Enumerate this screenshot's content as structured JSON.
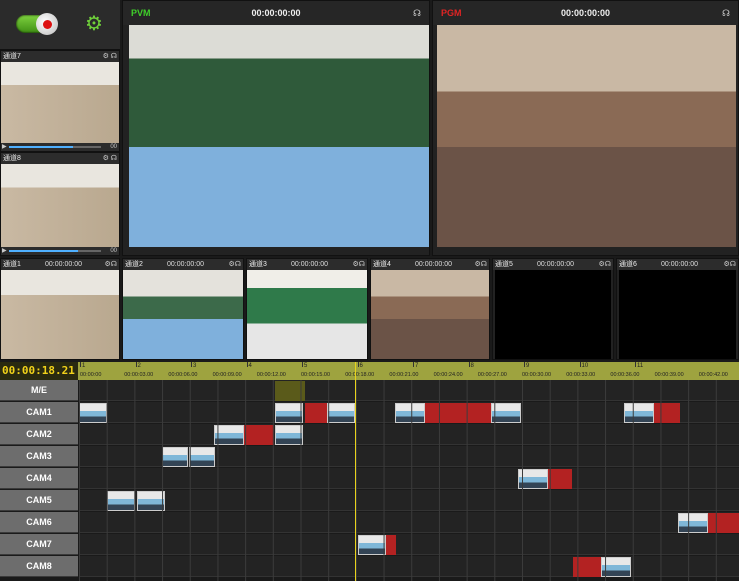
{
  "pvm": {
    "label": "PVM",
    "timecode": "00:00:00:00",
    "label_color": "#3fcf2a"
  },
  "pgm": {
    "label": "PGM",
    "timecode": "00:00:00:00",
    "label_color": "#e02424"
  },
  "side_channels": [
    {
      "name": "通道7",
      "time": "00"
    },
    {
      "name": "通道8",
      "time": "00"
    }
  ],
  "channels": [
    {
      "name": "通道1",
      "timecode": "00:00:00:00"
    },
    {
      "name": "通道2",
      "timecode": "00:00:00:00"
    },
    {
      "name": "通道3",
      "timecode": "00:00:00:00"
    },
    {
      "name": "通道4",
      "timecode": "00:00:00:00"
    },
    {
      "name": "通道5",
      "timecode": "00:00:00:00"
    },
    {
      "name": "通道6",
      "timecode": "00:00:00:00"
    }
  ],
  "timeline": {
    "current": "00:00:18.21",
    "major_ticks": [
      "1",
      "2",
      "3",
      "4",
      "5",
      "6",
      "7",
      "8",
      "9",
      "10",
      "11"
    ],
    "minor_ticks": [
      "00:00:00",
      "00:00:03.00",
      "00:00:06.00",
      "00:00:09.00",
      "00:00:12.00",
      "00:00:15.00",
      "00:00:18.00",
      "00:00:21.00",
      "00:00:24.00",
      "00:00:27.00",
      "00:00:30.00",
      "00:00:33.00",
      "00:00:36.00",
      "00:00:39.00",
      "00:00:42.00"
    ],
    "tracks": [
      "M/E",
      "CAM1",
      "CAM2",
      "CAM3",
      "CAM4",
      "CAM5",
      "CAM6",
      "CAM7",
      "CAM8"
    ]
  },
  "colors": {
    "accent": "#6fd03a",
    "playhead": "#e8d21c",
    "clip": "#b32222"
  }
}
